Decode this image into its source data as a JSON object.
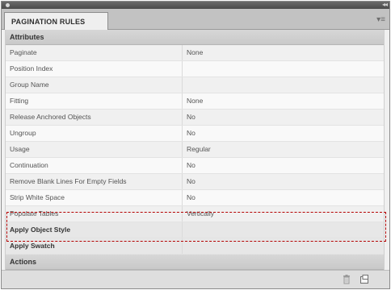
{
  "panel": {
    "tab_title": "PAGINATION RULES"
  },
  "sections": {
    "attributes_label": "Attributes",
    "actions_label": "Actions"
  },
  "rows": [
    {
      "name": "Paginate",
      "value": "None"
    },
    {
      "name": "Position Index",
      "value": ""
    },
    {
      "name": "Group Name",
      "value": ""
    },
    {
      "name": "Fitting",
      "value": "None"
    },
    {
      "name": "Release Anchored Objects",
      "value": "No"
    },
    {
      "name": "Ungroup",
      "value": "No"
    },
    {
      "name": "Usage",
      "value": "Regular"
    },
    {
      "name": "Continuation",
      "value": "No"
    },
    {
      "name": "Remove Blank Lines For Empty Fields",
      "value": "No"
    },
    {
      "name": "Strip White Space",
      "value": "No"
    },
    {
      "name": "Populate Tables",
      "value": "Vertically"
    },
    {
      "name": "Apply Object Style",
      "value": ""
    },
    {
      "name": "Apply Swatch",
      "value": ""
    }
  ],
  "icons": {
    "titlebar_dot": "panel-close-dot-icon",
    "collapse": "collapse-panel-icon",
    "panel_menu": "panel-menu-icon",
    "delete": "trash-icon",
    "new": "new-item-icon"
  },
  "colors": {
    "selection_outline": "#b40000"
  }
}
